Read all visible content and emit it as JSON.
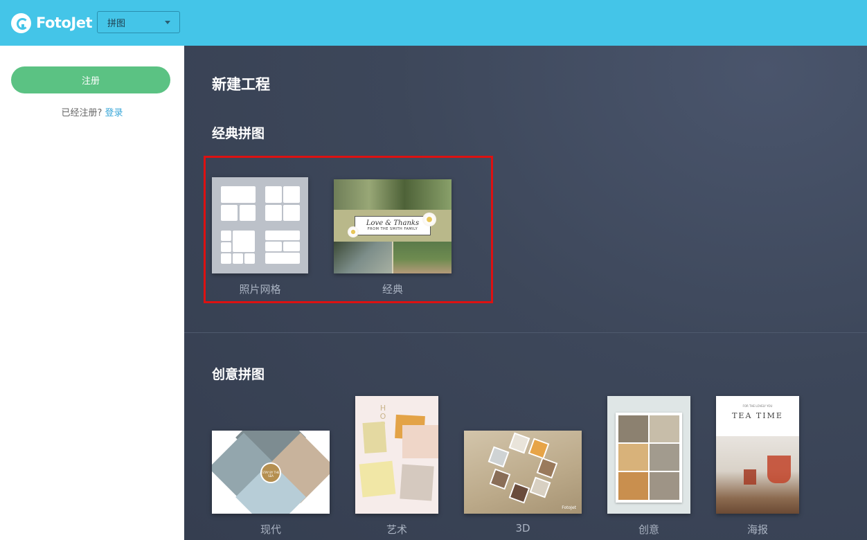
{
  "header": {
    "logo_text": "FotoJet",
    "mode_select": "拼图"
  },
  "sidebar": {
    "register_label": "注册",
    "login_prompt": "已经注册?",
    "login_link": "登录"
  },
  "main": {
    "title": "新建工程",
    "classic_section": {
      "title": "经典拼图",
      "items": [
        {
          "label": "照片网格",
          "thumb_text": ""
        },
        {
          "label": "经典",
          "thumb_line1": "Love & Thanks",
          "thumb_line2": "FROM THE SMITH FAMILY"
        }
      ]
    },
    "creative_section": {
      "title": "创意拼图",
      "items": [
        {
          "label": "现代",
          "thumb_text": "STAY BY THE SEA"
        },
        {
          "label": "艺术",
          "thumb_text": "HOPE"
        },
        {
          "label": "3D",
          "thumb_text": "FotoJet"
        },
        {
          "label": "创意",
          "thumb_text": ""
        },
        {
          "label": "海报",
          "thumb_line1": "FOR THE LOVELY YOU",
          "thumb_line2": "TEA TIME"
        }
      ]
    }
  },
  "colors": {
    "header_bg": "#44c5e8",
    "main_bg": "#3c465a",
    "register_bg": "#5bc283",
    "link": "#3aa7d8",
    "highlight": "#dd1111"
  }
}
